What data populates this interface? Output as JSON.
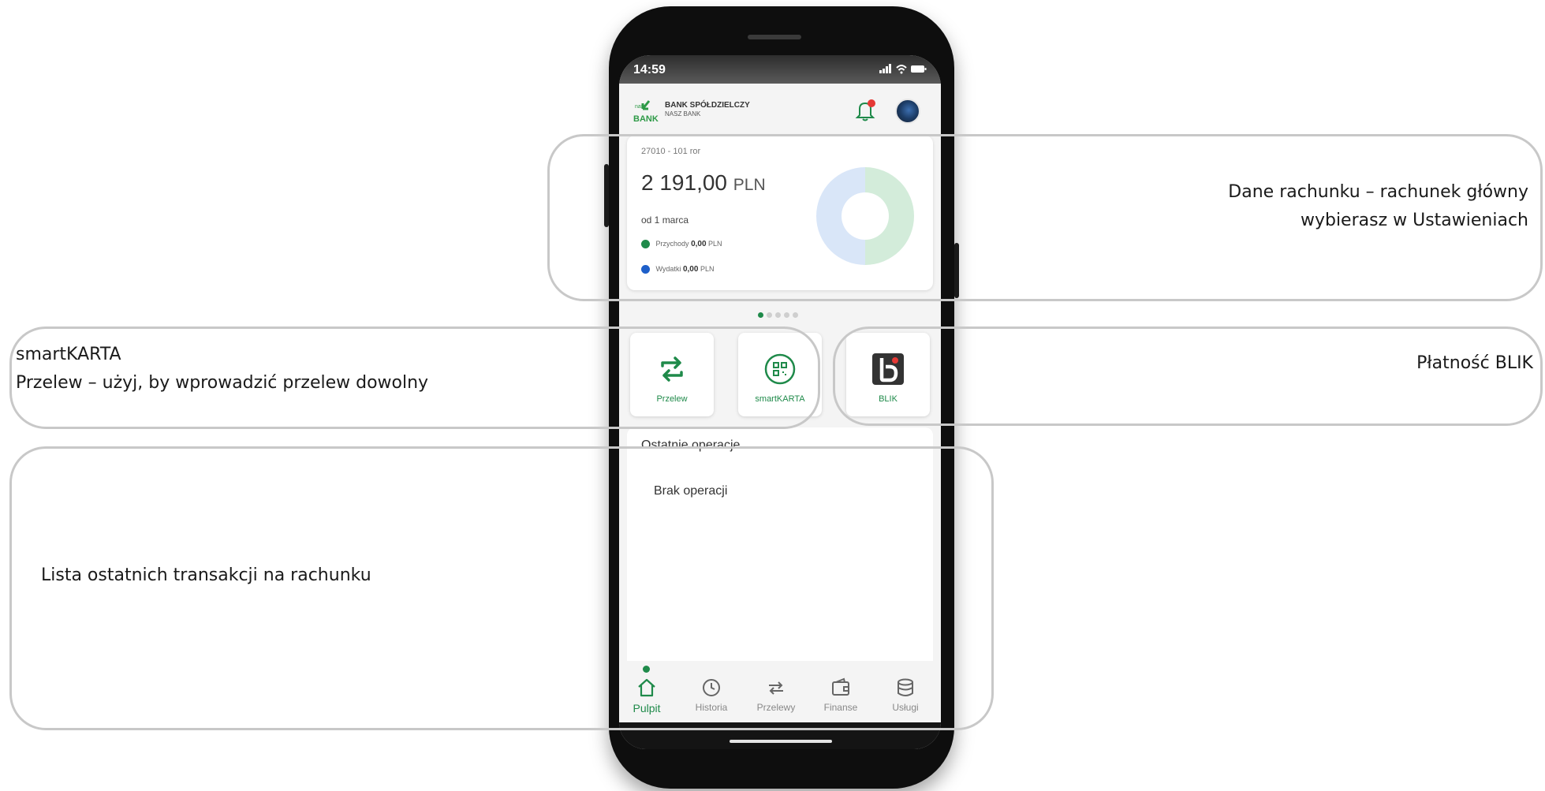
{
  "annotations": {
    "account": [
      "Dane rachunku – rachunek główny",
      "wybierasz w Ustawieniach"
    ],
    "left_top": [
      "smartKARTA",
      "Przelew – użyj, by wprowadzić przelew dowolny"
    ],
    "blik": "Płatność BLIK",
    "transactions": "Lista ostatnich transakcji na rachunku"
  },
  "status_bar": {
    "time": "14:59",
    "icons": "signal-icon wifi-icon battery-icon"
  },
  "header": {
    "logo_small": "nasz",
    "logo_bank": "BANK",
    "bank_name": "BANK SPÓŁDZIELCZY",
    "bank_sub": "NASZ BANK",
    "bell_icon": "bell-icon",
    "notification_color": "#e53935"
  },
  "account_card": {
    "account_number": "27010 - 101 ror",
    "balance": "2 191,00",
    "currency": "PLN",
    "period": "od 1 marca",
    "income_label": "Przychody",
    "income_amount": "0,00",
    "income_currency": "PLN",
    "expense_label": "Wydatki",
    "expense_amount": "0,00",
    "expense_currency": "PLN",
    "income_color": "#1f8a4a",
    "expense_color": "#1e5fc9"
  },
  "pager": {
    "count": 5,
    "active": 0
  },
  "quick_actions": [
    {
      "label": "Przelew",
      "icon": "transfer-icon"
    },
    {
      "label": "smartKARTA",
      "icon": "qr-icon"
    },
    {
      "label": "BLIK",
      "icon": "blik-icon"
    }
  ],
  "operations": {
    "title": "Ostatnie operacje",
    "empty": "Brak operacji"
  },
  "tabs": [
    {
      "label": "Pulpit",
      "icon": "home-icon",
      "active": true
    },
    {
      "label": "Historia",
      "icon": "history-icon",
      "active": false
    },
    {
      "label": "Przelewy",
      "icon": "transfer-icon",
      "active": false
    },
    {
      "label": "Finanse",
      "icon": "wallet-icon",
      "active": false
    },
    {
      "label": "Usługi",
      "icon": "database-icon",
      "active": false
    }
  ],
  "colors": {
    "brand": "#1f8a4a",
    "frame": "#c8c8c8"
  }
}
